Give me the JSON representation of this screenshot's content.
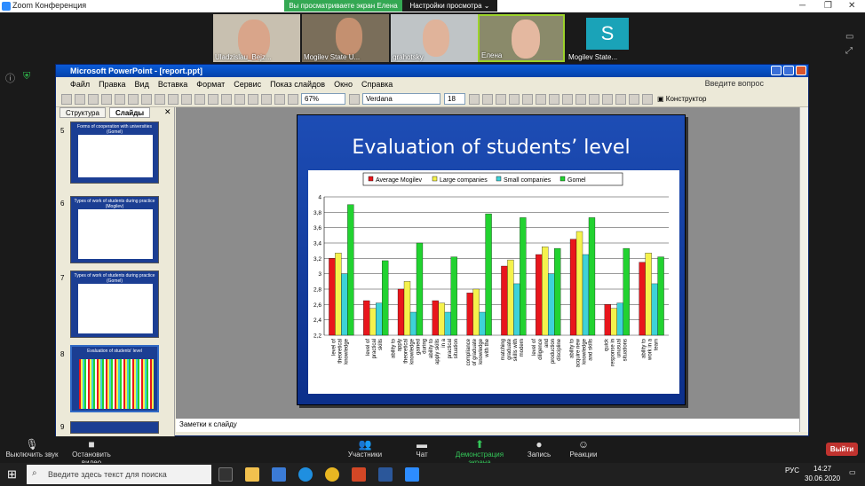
{
  "zoom": {
    "window_title": "Zoom Конференция",
    "share_banner": "Вы просматриваете экран Елена",
    "view_settings": "Настройки просмотра",
    "participants": [
      {
        "name": "Uladzislau_Bejz...",
        "kind": "video"
      },
      {
        "name": "Mogilev State U...",
        "kind": "video"
      },
      {
        "name": "grahotsky",
        "kind": "video"
      },
      {
        "name": "Елена",
        "kind": "video"
      },
      {
        "name": "Mogilev State...",
        "kind": "avatar",
        "initial": "S"
      }
    ],
    "controls": [
      {
        "label": "Выключить звук",
        "icon": "microphone-icon"
      },
      {
        "label": "Остановить видео",
        "icon": "video-camera-icon"
      },
      {
        "label": "Участники",
        "icon": "participants-icon"
      },
      {
        "label": "Чат",
        "icon": "chat-icon"
      },
      {
        "label": "Демонстрация экрана",
        "icon": "share-screen-icon"
      },
      {
        "label": "Запись",
        "icon": "record-icon"
      },
      {
        "label": "Реакции",
        "icon": "reactions-icon"
      }
    ],
    "leave_label": "Выйти"
  },
  "ppt": {
    "title": "Microsoft PowerPoint - [report.ppt]",
    "menu": [
      "Файл",
      "Правка",
      "Вид",
      "Вставка",
      "Формат",
      "Сервис",
      "Показ слайдов",
      "Окно",
      "Справка"
    ],
    "help_box": "Введите вопрос",
    "zoom_level": "67%",
    "font_name": "Verdana",
    "font_size": "18",
    "designer_label": "Конструктор",
    "panel_tabs": [
      "Структура",
      "Слайды"
    ],
    "thumbnails": [
      {
        "num": "5",
        "title": "Forms of cooperation with universities (Gomel)"
      },
      {
        "num": "6",
        "title": "Types of work of students during practice (Mogilev)"
      },
      {
        "num": "7",
        "title": "Types of work of students during practice (Gomel)"
      },
      {
        "num": "8",
        "title": "Evaluation of students' level"
      },
      {
        "num": "9",
        "title": ""
      }
    ],
    "notes_placeholder": "Заметки к слайду",
    "slide_title": "Evaluation of students’ level"
  },
  "chart_data": {
    "type": "bar",
    "categories": [
      "level of theoretical knowledge",
      "level of practical skills",
      "ability to apply theoretical knowledge gained during",
      "ability to apply skills in a practical situation",
      "compliance of graduate knowledge with the",
      "matching graduate skills with modern",
      "level of diligence and production discipline",
      "ability to acquire new knowledge and skills",
      "quick response in unusual situations",
      "ability to work in a team"
    ],
    "series": [
      {
        "name": "Average Mogilev",
        "color": "#e8161c",
        "values": [
          3.2,
          2.65,
          2.8,
          2.65,
          2.75,
          3.1,
          3.25,
          3.45,
          2.6,
          3.15
        ]
      },
      {
        "name": "Large companies",
        "color": "#f5f24c",
        "values": [
          3.27,
          2.55,
          2.9,
          2.62,
          2.8,
          3.18,
          3.35,
          3.55,
          2.55,
          3.27
        ]
      },
      {
        "name": "Small companies",
        "color": "#3ed2d8",
        "values": [
          3.0,
          2.62,
          2.5,
          2.5,
          2.5,
          2.87,
          3.0,
          3.25,
          2.62,
          2.87
        ]
      },
      {
        "name": "Gomel",
        "color": "#22d230",
        "values": [
          3.9,
          3.17,
          3.4,
          3.22,
          3.78,
          3.73,
          3.33,
          3.73,
          3.33,
          3.22
        ]
      }
    ],
    "ylim": [
      2.2,
      4.0
    ],
    "yticks": [
      "2,2",
      "2,4",
      "2,6",
      "2,8",
      "3",
      "3,2",
      "3,4",
      "3,6",
      "3,8",
      "4"
    ],
    "grid": true,
    "legend": "top"
  },
  "taskbar": {
    "search_placeholder": "Введите здесь текст для поиска",
    "lang": "РУС",
    "time": "14:27",
    "date": "30.06.2020"
  }
}
